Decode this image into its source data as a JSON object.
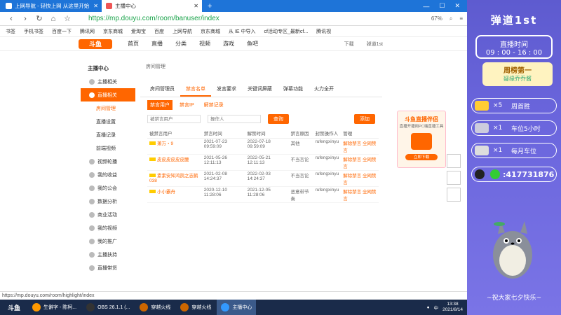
{
  "browser": {
    "tabs": [
      {
        "label": "上网导航 - 轻快上网 从这里开始"
      },
      {
        "label": "主播中心"
      }
    ],
    "url": "https://mp.douyu.com/room/banuser/index",
    "zoom": "67%",
    "bookmarks": [
      "书签",
      "手机书签",
      "百度一下",
      "腾讯网",
      "京东商城",
      "爱淘宝",
      "百度",
      "上网导航",
      "京东商城",
      "从 IE 中导入",
      "cf活动专区_最新cf...",
      "腾讯视"
    ]
  },
  "site": {
    "logo": "斗鱼",
    "nav": [
      "首页",
      "直播",
      "分类",
      "视频",
      "游戏",
      "鱼吧"
    ],
    "header_right": [
      "下载",
      "弹道1st"
    ]
  },
  "sidebar": {
    "title": "主播中心",
    "items": [
      {
        "label": "主播相关"
      },
      {
        "label": "直播相关"
      }
    ],
    "subitems": [
      "房间管理",
      "直播设置",
      "直播记录",
      "前端视频"
    ],
    "more": [
      "视频轮播",
      "我的收益",
      "我的公会",
      "数据分析",
      "商业活动",
      "我的视频",
      "我的推广",
      "主播扶持",
      "直播带货"
    ]
  },
  "main": {
    "breadcrumb": "房间管理",
    "tabs": [
      "房间管理员",
      "禁言名单",
      "发言要求",
      "关键词屏蔽",
      "弹幕功能",
      "火力全开"
    ],
    "subtabs": [
      "禁言用户",
      "禁言IP",
      "解禁记录"
    ],
    "filter_user_placeholder": "被禁言用户",
    "filter_operator_placeholder": "操作人",
    "query_label": "查询",
    "add_label": "添加",
    "columns": [
      "被禁言用户",
      "禁言时间",
      "解禁时间",
      "禁言原因",
      "封禁操作人",
      "管理"
    ],
    "rows": [
      {
        "user": "萧万・9",
        "ban": "2021-07-23 09:59:09",
        "unban": "2022-07-18 09:59:09",
        "reason": "其他",
        "op": "rufengxinyu",
        "act": "解除禁言 全网禁言"
      },
      {
        "user": "皮皮皮皮皮皮腰",
        "ban": "2021-05-26 12:11:13",
        "unban": "2022-05-21 12:11:13",
        "reason": "不当言论",
        "op": "rufengxinyu",
        "act": "解除禁言 全网禁言"
      },
      {
        "user": "素素安知鸿鹄之志鹤038",
        "ban": "2021-02-08 14:24:37",
        "unban": "2022-02-03 14:24:37",
        "reason": "不当言论",
        "op": "rufengxinyu",
        "act": "解除禁言 全网禁言"
      },
      {
        "user": "小小霸舟",
        "ban": "2020-12-10 11:28:06",
        "unban": "2021-12-05 11:28:06",
        "reason": "恶意带节奏",
        "op": "rufengxinyu",
        "act": "解除禁言 全网禁言"
      }
    ]
  },
  "floatad": {
    "title": "斗鱼直播伴侣",
    "sub": "直播开播用PC端直播工具",
    "dl": "立即下载"
  },
  "statusbar": "https://mp.douyu.com/room/highlight/index",
  "taskbar": {
    "apps": [
      "生僻字 - 陈柯...",
      "OBS 26.1.1 (...",
      "穿越火线",
      "穿越火线",
      "主播中心"
    ],
    "time": "13:38",
    "date": "2021/8/14",
    "lang": "中"
  },
  "overlay": {
    "title": "弹道1st",
    "live_label": "直播时间",
    "live_time": "09 : 00 - 16 : 00",
    "rank_title": "周榜第一",
    "rank_sub": "疑缘乔乔酱",
    "rows": [
      {
        "count": "×5",
        "label": "周首胜"
      },
      {
        "count": "×1",
        "label": "车位5小时"
      },
      {
        "count": "×1",
        "label": "每月车位"
      }
    ],
    "qq": ":417731876",
    "footer": "~祝大家七夕快乐~"
  }
}
